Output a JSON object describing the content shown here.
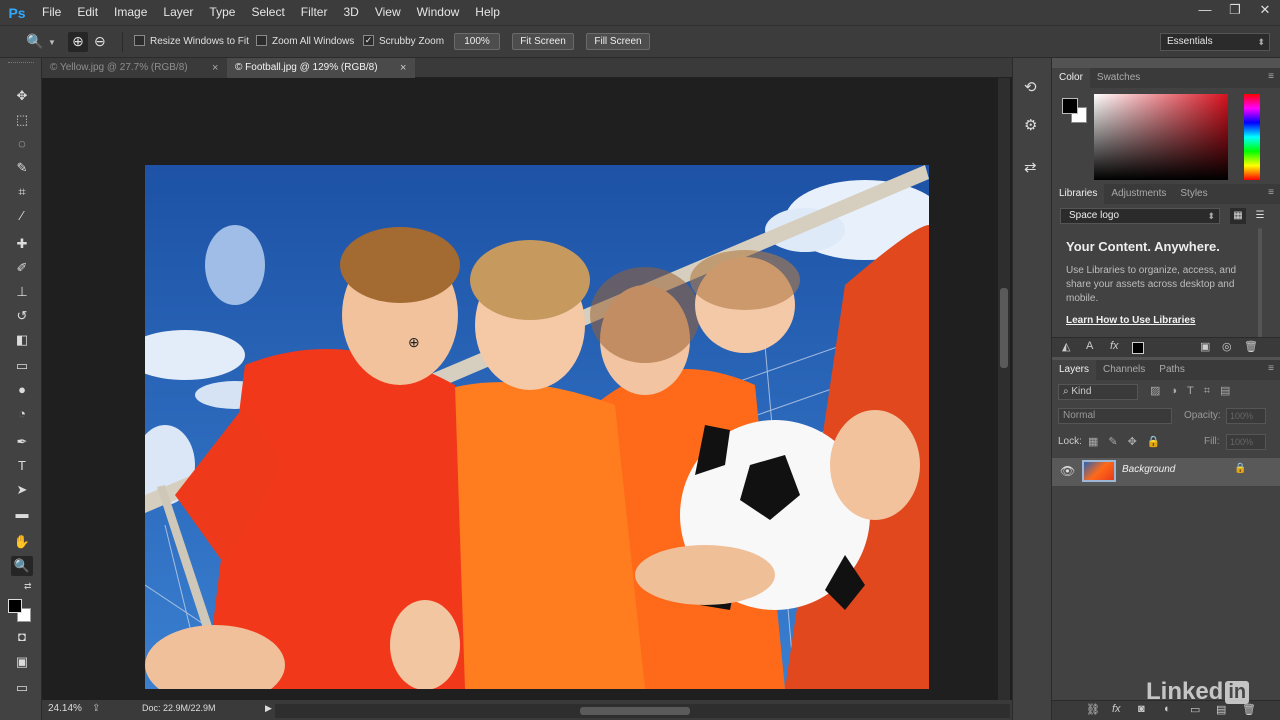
{
  "app": {
    "logo": "Ps"
  },
  "menu": [
    "File",
    "Edit",
    "Image",
    "Layer",
    "Type",
    "Select",
    "Filter",
    "3D",
    "View",
    "Window",
    "Help"
  ],
  "window_controls": {
    "minimize": "—",
    "restore": "❐",
    "close": "✕"
  },
  "options": {
    "zoom_tool_icon": "🔍",
    "zoom_in_icon": "⊕",
    "zoom_out_icon": "⊖",
    "resize_windows": {
      "label": "Resize Windows to Fit",
      "checked": false
    },
    "zoom_all": {
      "label": "Zoom All Windows",
      "checked": false
    },
    "scrubby": {
      "label": "Scrubby Zoom",
      "checked": true,
      "mark": "✓"
    },
    "btn_100": "100%",
    "btn_fit": "Fit Screen",
    "btn_fill": "Fill Screen"
  },
  "workspace": {
    "value": "Essentials",
    "arrow": "⬍"
  },
  "document_tabs": [
    {
      "title": "© Yellow.jpg @ 27.7% (RGB/8)",
      "close": "×",
      "active": false
    },
    {
      "title": "© Football.jpg @ 129% (RGB/8)",
      "close": "×",
      "active": true
    }
  ],
  "tools": [
    {
      "name": "move-tool",
      "glyph": "✥"
    },
    {
      "name": "marquee-tool",
      "glyph": "⬚"
    },
    {
      "name": "lasso-tool",
      "glyph": "◌"
    },
    {
      "name": "quick-selection-tool",
      "glyph": "✎"
    },
    {
      "name": "crop-tool",
      "glyph": "⌗"
    },
    {
      "name": "eyedropper-tool",
      "glyph": "⁄"
    },
    {
      "name": "healing-brush-tool",
      "glyph": "✚"
    },
    {
      "name": "brush-tool",
      "glyph": "✐"
    },
    {
      "name": "clone-stamp-tool",
      "glyph": "⊥"
    },
    {
      "name": "history-brush-tool",
      "glyph": "↺"
    },
    {
      "name": "eraser-tool",
      "glyph": "◧"
    },
    {
      "name": "gradient-tool",
      "glyph": "▭"
    },
    {
      "name": "blur-tool",
      "glyph": "●"
    },
    {
      "name": "dodge-tool",
      "glyph": "◔"
    },
    {
      "name": "pen-tool",
      "glyph": "✒"
    },
    {
      "name": "type-tool",
      "glyph": "T"
    },
    {
      "name": "path-selection-tool",
      "glyph": "➤"
    },
    {
      "name": "rectangle-tool",
      "glyph": "▬"
    },
    {
      "name": "hand-tool",
      "glyph": "✋"
    },
    {
      "name": "zoom-tool",
      "glyph": "🔍"
    },
    {
      "name": "edit-quick-mask-button",
      "glyph": "◘"
    },
    {
      "name": "screen-mode-button",
      "glyph": "▣"
    },
    {
      "name": "artboard-button",
      "glyph": "▭"
    }
  ],
  "status": {
    "zoom": "24.14%",
    "doc": "Doc: 22.9M/22.9M",
    "arrow": "▶"
  },
  "icon_strip": [
    {
      "name": "history-panel-icon",
      "glyph": "⟲"
    },
    {
      "name": "properties-panel-icon",
      "glyph": "⚙"
    },
    {
      "name": "paragraph-panel-icon",
      "glyph": "⇄"
    }
  ],
  "color_panel": {
    "tabs": [
      "Color",
      "Swatches"
    ]
  },
  "libraries_panel": {
    "tabs": [
      "Libraries",
      "Adjustments",
      "Styles"
    ],
    "library": "Space logo",
    "heading": "Your Content. Anywhere.",
    "body": "Use Libraries to organize, access, and share your assets across desktop and mobile.",
    "link": "Learn How to Use Libraries"
  },
  "layers_panel": {
    "tabs": [
      "Layers",
      "Channels",
      "Paths"
    ],
    "kind": "Kind",
    "blend_mode": "Normal",
    "opacity_label": "Opacity:",
    "opacity_value": "100%",
    "lock_label": "Lock:",
    "fill_label": "Fill:",
    "fill_value": "100%",
    "layer_name": "Background"
  },
  "watermark": {
    "brand": "Linked",
    "suffix": "in"
  }
}
